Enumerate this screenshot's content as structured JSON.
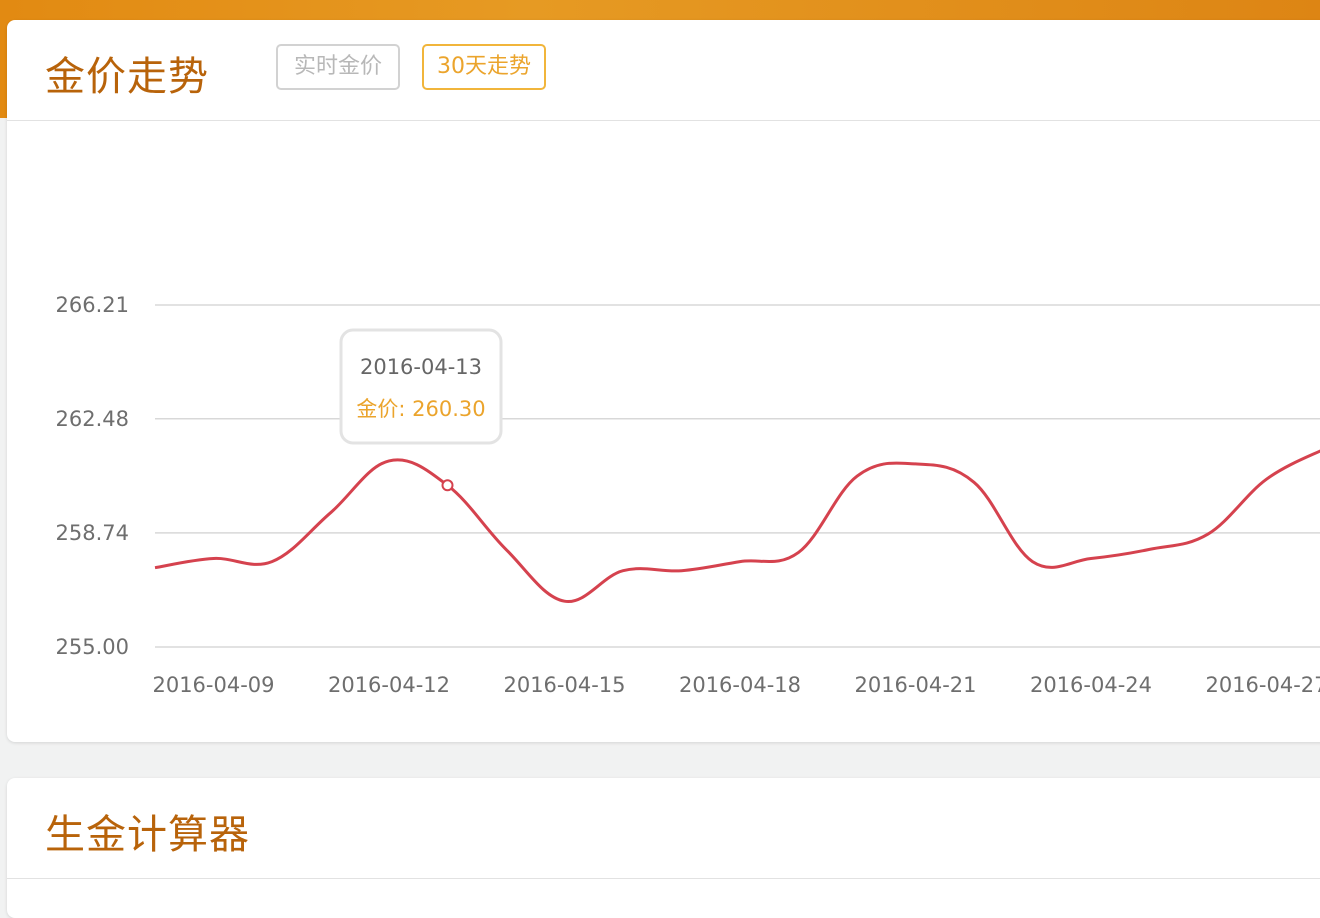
{
  "header": {
    "title": "金价走势",
    "tabs": [
      {
        "label": "实时金价",
        "active": false
      },
      {
        "label": "30天走势",
        "active": true
      }
    ]
  },
  "calculator": {
    "title": "生金计算器"
  },
  "colors": {
    "accent": "#e28a12",
    "title": "#b8630a",
    "active_tab": "#eba42c",
    "line": "#d5424e",
    "grid": "#d8d8d8"
  },
  "chart_data": {
    "type": "line",
    "title": "",
    "xlabel": "",
    "ylabel": "",
    "y_ticks": [
      "255.00",
      "258.74",
      "262.48",
      "266.21"
    ],
    "ylim": [
      255.0,
      266.21
    ],
    "x_ticks": [
      "2016-04-09",
      "2016-04-12",
      "2016-04-15",
      "2016-04-18",
      "2016-04-21",
      "2016-04-24",
      "2016-04-27"
    ],
    "x": [
      "2016-04-08",
      "2016-04-09",
      "2016-04-10",
      "2016-04-11",
      "2016-04-12",
      "2016-04-13",
      "2016-04-14",
      "2016-04-15",
      "2016-04-16",
      "2016-04-17",
      "2016-04-18",
      "2016-04-19",
      "2016-04-20",
      "2016-04-21",
      "2016-04-22",
      "2016-04-23",
      "2016-04-24",
      "2016-04-25",
      "2016-04-26",
      "2016-04-27",
      "2016-04-28"
    ],
    "series": [
      {
        "values": [
          257.6,
          257.9,
          257.8,
          259.4,
          261.1,
          260.3,
          258.2,
          256.5,
          257.5,
          257.5,
          257.8,
          258.1,
          260.6,
          261.0,
          260.4,
          257.8,
          257.9,
          258.2,
          258.7,
          260.5,
          261.5
        ]
      }
    ],
    "grid": true,
    "tooltip": {
      "date": "2016-04-13",
      "label": "金价: 260.30"
    }
  }
}
